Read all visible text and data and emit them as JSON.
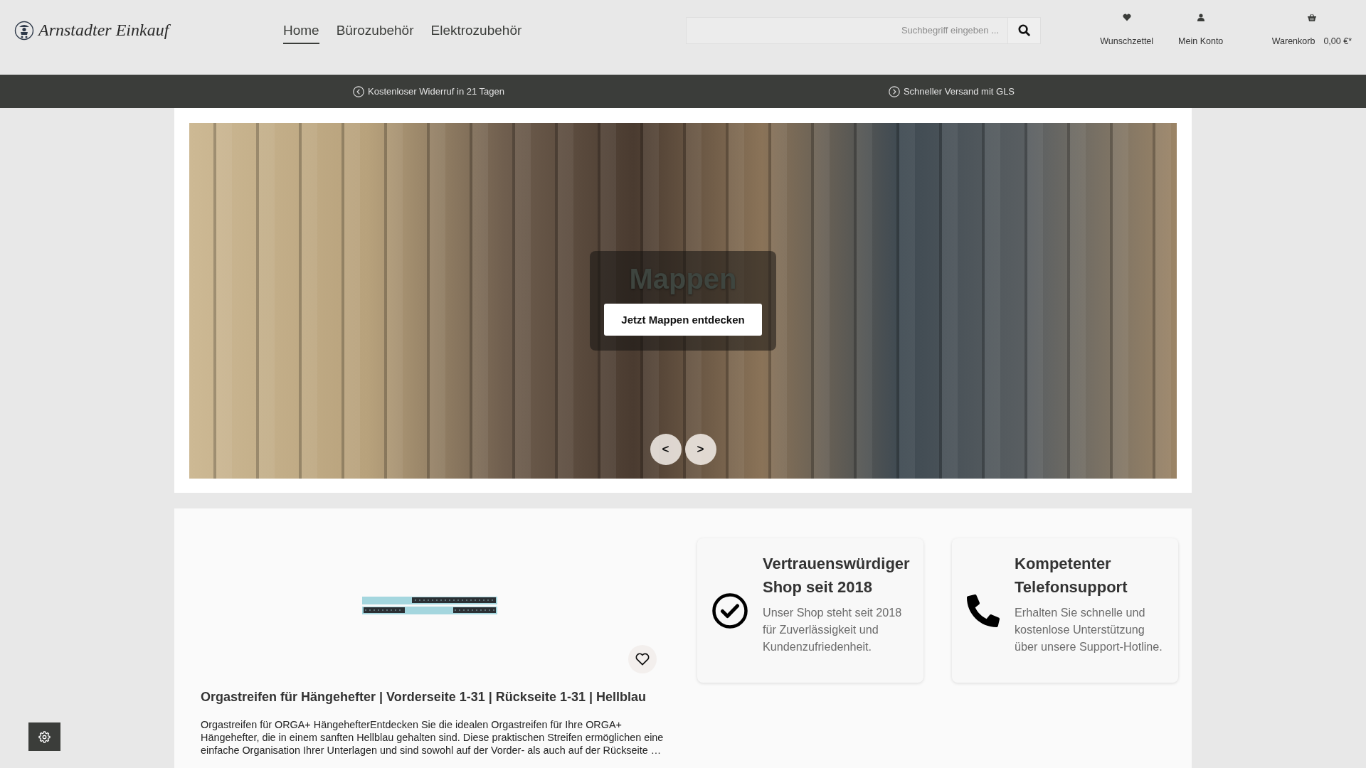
{
  "header": {
    "logo": "Arnstadter Einkauf",
    "nav": [
      {
        "label": "Home",
        "selected": true
      },
      {
        "label": "Bürozubehör",
        "selected": false
      },
      {
        "label": "Elektrozubehör",
        "selected": false
      }
    ],
    "search": {
      "placeholder": "Suchbegriff eingeben ..."
    },
    "actions": [
      {
        "kind": "wishlist",
        "label": "Wunschzettel"
      },
      {
        "kind": "account",
        "label": "Mein Konto"
      },
      {
        "kind": "cart",
        "label": "Warenkorb",
        "amount": "0,00 €*"
      }
    ]
  },
  "usp_bar": [
    {
      "kind": "return",
      "text": "Kostenloser Widerruf in 21 Tagen"
    },
    {
      "kind": "shipping",
      "text": "Schneller Versand mit GLS"
    }
  ],
  "slider": {
    "title": "Mappen",
    "button": "Jetzt Mappen entdecken",
    "prev": "<",
    "next": ">"
  },
  "product": {
    "title": "Orgastreifen für Hängehefter | Vorderseite 1-31 | Rückseite 1-31 | Hellblau",
    "description": "Orgastreifen für ORGA+ HängehefterEntdecken Sie die idealen Orgastreifen für Ihre ORGA+ Hängehefter, die in einem sanften Hellblau gehalten sind. Diese praktischen Streifen ermöglichen eine einfache Organisation Ihrer Unterlagen und sind sowohl auf der Vorder- als auch auf der Rückseite …"
  },
  "features": [
    {
      "kind": "trust",
      "title": "Vertrauenswürdiger Shop seit 2018",
      "text": "Unser Shop steht seit 2018 für Zuverlässigkeit und Kundenzufriedenheit."
    },
    {
      "kind": "phone",
      "title": "Kompetenter Telefonsupport",
      "text": "Erhalten Sie schnelle und kostenlose Unterstützung über unsere Support-Hotline."
    }
  ]
}
